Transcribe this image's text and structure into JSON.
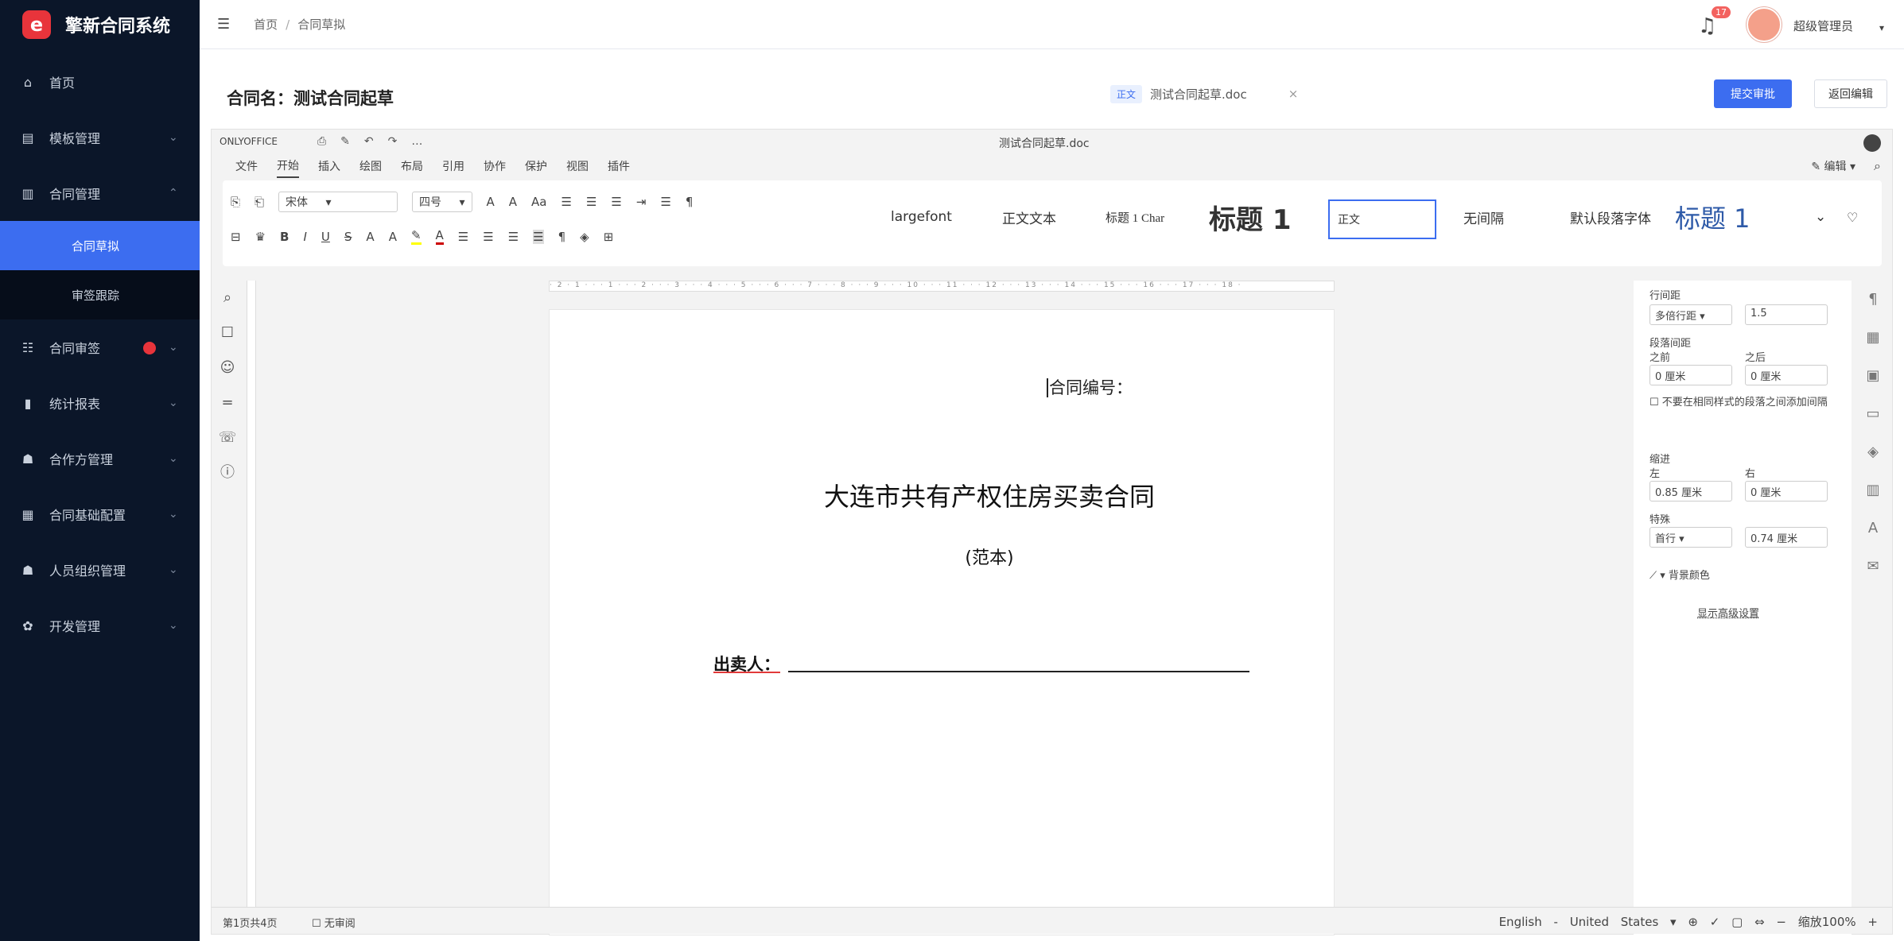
{
  "app": {
    "logo_text": "擎新合同系统"
  },
  "sidebar": {
    "items": [
      {
        "icon": "⌂",
        "label": "首页",
        "chev": ""
      },
      {
        "icon": "▤",
        "label": "模板管理",
        "chev": "⌄"
      },
      {
        "icon": "▥",
        "label": "合同管理",
        "chev": "⌃"
      }
    ],
    "sub": [
      {
        "label": "合同草拟",
        "active": true
      },
      {
        "label": "审签跟踪",
        "active": false
      }
    ],
    "items2": [
      {
        "icon": "☷",
        "label": "合同审签",
        "chev": "⌄",
        "badge": true
      },
      {
        "icon": "▮",
        "label": "统计报表",
        "chev": "⌄"
      },
      {
        "icon": "☗",
        "label": "合作方管理",
        "chev": "⌄"
      },
      {
        "icon": "▦",
        "label": "合同基础配置",
        "chev": "⌄"
      },
      {
        "icon": "☗",
        "label": "人员组织管理",
        "chev": "⌄"
      },
      {
        "icon": "✿",
        "label": "开发管理",
        "chev": "⌄"
      }
    ]
  },
  "topbar": {
    "crumb_home": "首页",
    "crumb_current": "合同草拟",
    "notif_count": "17",
    "username": "超级管理员"
  },
  "doc": {
    "title": "合同名：测试合同起草",
    "tab_tag": "正文",
    "tab_file": "测试合同起草.doc",
    "submit": "提交审批",
    "back": "返回编辑"
  },
  "oo": {
    "brand": "ONLYOFFICE",
    "file_name": "测试合同起草.doc",
    "tabs": [
      "文件",
      "开始",
      "插入",
      "绘图",
      "布局",
      "引用",
      "协作",
      "保护",
      "视图",
      "插件"
    ],
    "view": "编辑",
    "font": "宋体",
    "size": "四号",
    "styles": [
      "largefont",
      "正文文本",
      "标题 1 Char",
      "标题 1",
      "正文",
      "无间隔",
      "默认段落字体",
      "标题 1"
    ]
  },
  "page": {
    "contract_no": "合同编号：",
    "title": "大连市共有产权住房买卖合同",
    "subtitle": "(范本)",
    "seller": "出卖人："
  },
  "panel": {
    "line_spacing": "行间距",
    "ls_type": "多倍行距",
    "ls_val": "1.5",
    "para_spacing": "段落间距",
    "before": "之前",
    "after": "之后",
    "before_val": "0 厘米",
    "after_val": "0 厘米",
    "checkbox": "不要在相同样式的段落之间添加间隔",
    "indent": "缩进",
    "left": "左",
    "right": "右",
    "left_val": "0.85 厘米",
    "right_val": "0 厘米",
    "special": "特殊",
    "special_type": "首行",
    "special_val": "0.74 厘米",
    "bg": "背景颜色",
    "advanced": "显示高级设置"
  },
  "status": {
    "page": "第1页共4页",
    "track": "无审阅",
    "lang": "English - United States",
    "zoom": "缩放100%"
  }
}
